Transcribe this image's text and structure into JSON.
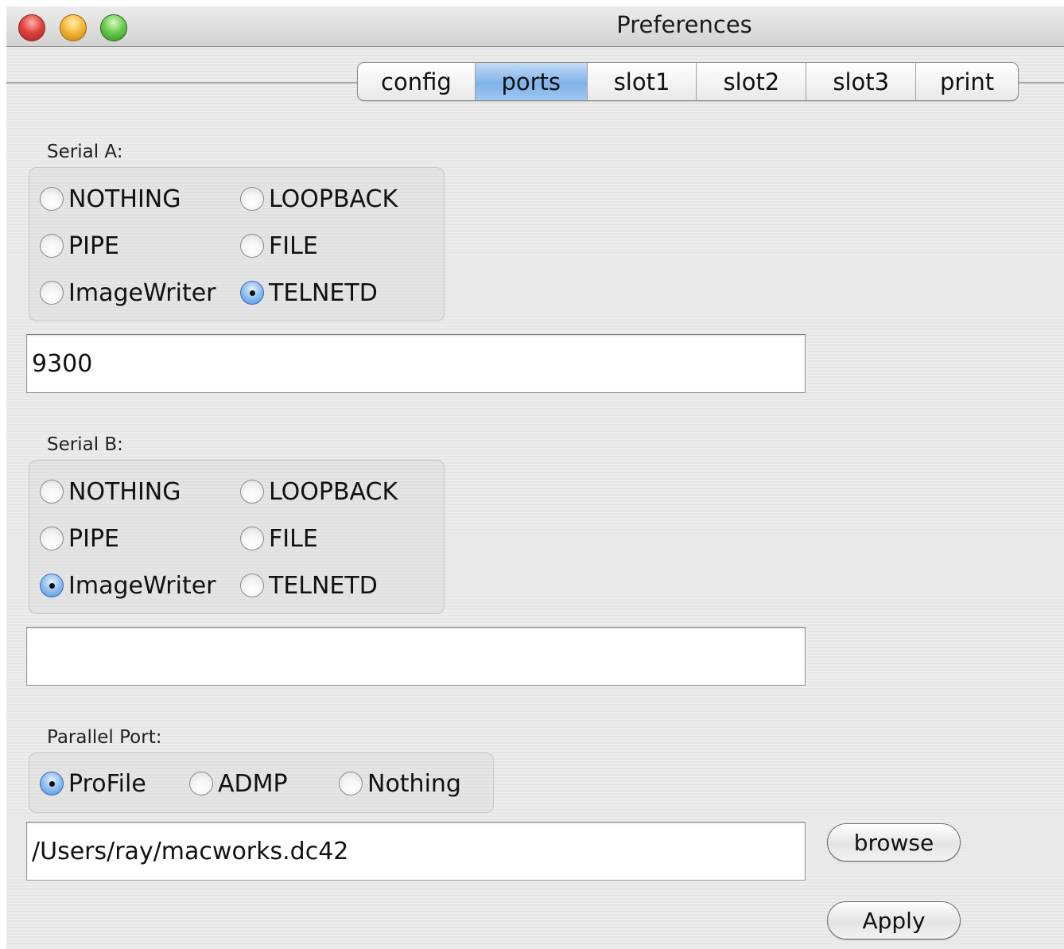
{
  "window": {
    "title": "Preferences"
  },
  "tabs": [
    {
      "label": "config"
    },
    {
      "label": "ports"
    },
    {
      "label": "slot1"
    },
    {
      "label": "slot2"
    },
    {
      "label": "slot3"
    },
    {
      "label": "print"
    }
  ],
  "active_tab": "ports",
  "serial_a": {
    "label": "Serial A:",
    "options": [
      "NOTHING",
      "LOOPBACK",
      "PIPE",
      "FILE",
      "ImageWriter",
      "TELNETD"
    ],
    "selected": "TELNETD",
    "field_value": "9300"
  },
  "serial_b": {
    "label": "Serial B:",
    "options": [
      "NOTHING",
      "LOOPBACK",
      "PIPE",
      "FILE",
      "ImageWriter",
      "TELNETD"
    ],
    "selected": "ImageWriter",
    "field_value": ""
  },
  "parallel": {
    "label": "Parallel Port:",
    "options": [
      "ProFile",
      "ADMP",
      "Nothing"
    ],
    "selected": "ProFile",
    "field_value": "/Users/ray/macworks.dc42"
  },
  "buttons": {
    "browse": "browse",
    "apply": "Apply"
  },
  "colors": {
    "selected_tab": "#7fb2ea",
    "radio_selected": "#4d8fdc"
  }
}
